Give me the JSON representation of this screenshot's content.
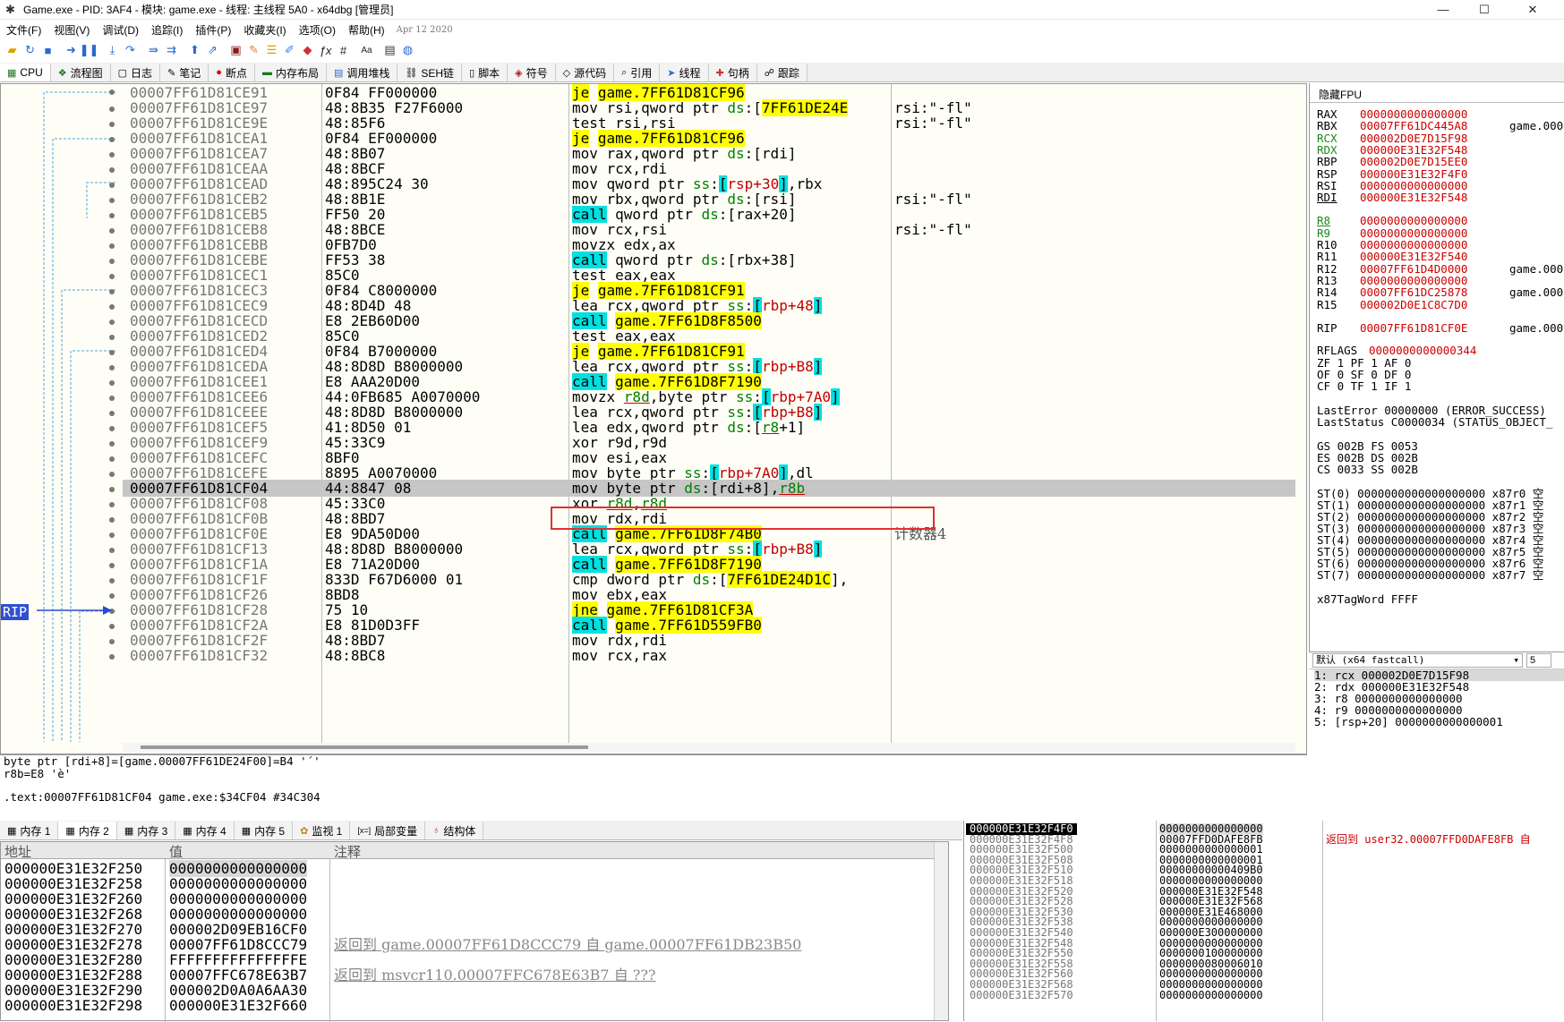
{
  "window": {
    "title": "Game.exe - PID: 3AF4 - 模块: game.exe - 线程: 主线程 5A0 - x64dbg [管理员]"
  },
  "menu": {
    "items": [
      "文件(F)",
      "视图(V)",
      "调试(D)",
      "追踪(I)",
      "插件(P)",
      "收藏夹(I)",
      "选项(O)",
      "帮助(H)"
    ],
    "date": "Apr 12 2020"
  },
  "tabs": [
    {
      "icon": "cpu-icon",
      "label": "CPU"
    },
    {
      "icon": "flowchart-icon",
      "label": "流程图"
    },
    {
      "icon": "log-icon",
      "label": "日志"
    },
    {
      "icon": "notes-icon",
      "label": "笔记"
    },
    {
      "icon": "breakpoint-icon",
      "label": "断点"
    },
    {
      "icon": "memory-map-icon",
      "label": "内存布局"
    },
    {
      "icon": "callstack-icon",
      "label": "调用堆栈"
    },
    {
      "icon": "seh-icon",
      "label": "SEH链"
    },
    {
      "icon": "script-icon",
      "label": "脚本"
    },
    {
      "icon": "symbols-icon",
      "label": "符号"
    },
    {
      "icon": "source-icon",
      "label": "源代码"
    },
    {
      "icon": "references-icon",
      "label": "引用"
    },
    {
      "icon": "threads-icon",
      "label": "线程"
    },
    {
      "icon": "handles-icon",
      "label": "句柄"
    },
    {
      "icon": "trace-icon",
      "label": "跟踪"
    }
  ],
  "disasm": {
    "rows": [
      {
        "addr": "00007FF61D81CE91",
        "bytes": "0F84 FF000000",
        "d": [
          [
            "je",
            "y"
          ],
          [
            " "
          ],
          [
            "game.7FF61D81CF96",
            "y"
          ]
        ],
        "c": ""
      },
      {
        "addr": "00007FF61D81CE97",
        "bytes": "48:8B35 F27F6000",
        "d": [
          [
            "mov rsi,qword ptr "
          ],
          [
            "ds",
            "g"
          ],
          [
            ":["
          ],
          [
            "7FF61DE24E",
            "y"
          ]
        ],
        "c": "rsi:\"-fl\""
      },
      {
        "addr": "00007FF61D81CE9E",
        "bytes": "48:85F6",
        "d": [
          [
            "test rsi,rsi"
          ]
        ],
        "c": "rsi:\"-fl\""
      },
      {
        "addr": "00007FF61D81CEA1",
        "bytes": "0F84 EF000000",
        "d": [
          [
            "je",
            "y"
          ],
          [
            " "
          ],
          [
            "game.7FF61D81CF96",
            "y"
          ]
        ],
        "c": ""
      },
      {
        "addr": "00007FF61D81CEA7",
        "bytes": "48:8B07",
        "d": [
          [
            "mov rax,qword ptr "
          ],
          [
            "ds",
            "g"
          ],
          [
            ":[rdi]"
          ]
        ],
        "c": ""
      },
      {
        "addr": "00007FF61D81CEAA",
        "bytes": "48:8BCF",
        "d": [
          [
            "mov rcx,rdi"
          ]
        ],
        "c": ""
      },
      {
        "addr": "00007FF61D81CEAD",
        "bytes": "48:895C24 30",
        "d": [
          [
            "mov qword ptr "
          ],
          [
            "ss",
            "g"
          ],
          [
            ":"
          ],
          [
            "[",
            "c"
          ],
          [
            "rsp+30",
            "r"
          ],
          [
            "]",
            "c"
          ],
          [
            ",rbx"
          ]
        ],
        "c": ""
      },
      {
        "addr": "00007FF61D81CEB2",
        "bytes": "48:8B1E",
        "d": [
          [
            "mov rbx,qword ptr "
          ],
          [
            "ds",
            "g"
          ],
          [
            ":[rsi]"
          ]
        ],
        "c": "rsi:\"-fl\""
      },
      {
        "addr": "00007FF61D81CEB5",
        "bytes": "FF50 20",
        "d": [
          [
            "call",
            "c"
          ],
          [
            " qword ptr "
          ],
          [
            "ds",
            "g"
          ],
          [
            ":[rax+20]"
          ]
        ],
        "c": ""
      },
      {
        "addr": "00007FF61D81CEB8",
        "bytes": "48:8BCE",
        "d": [
          [
            "mov rcx,rsi"
          ]
        ],
        "c": "rsi:\"-fl\""
      },
      {
        "addr": "00007FF61D81CEBB",
        "bytes": "0FB7D0",
        "d": [
          [
            "movzx edx,ax"
          ]
        ],
        "c": ""
      },
      {
        "addr": "00007FF61D81CEBE",
        "bytes": "FF53 38",
        "d": [
          [
            "call",
            "c"
          ],
          [
            " qword ptr "
          ],
          [
            "ds",
            "g"
          ],
          [
            ":[rbx+38]"
          ]
        ],
        "c": ""
      },
      {
        "addr": "00007FF61D81CEC1",
        "bytes": "85C0",
        "d": [
          [
            "test eax,eax"
          ]
        ],
        "c": ""
      },
      {
        "addr": "00007FF61D81CEC3",
        "bytes": "0F84 C8000000",
        "d": [
          [
            "je",
            "y"
          ],
          [
            " "
          ],
          [
            "game.7FF61D81CF91",
            "y"
          ]
        ],
        "c": ""
      },
      {
        "addr": "00007FF61D81CEC9",
        "bytes": "48:8D4D 48",
        "d": [
          [
            "lea rcx,qword ptr "
          ],
          [
            "ss",
            "g"
          ],
          [
            ":"
          ],
          [
            "[",
            "c"
          ],
          [
            "rbp+48",
            "r"
          ],
          [
            "]",
            "c"
          ]
        ],
        "c": ""
      },
      {
        "addr": "00007FF61D81CECD",
        "bytes": "E8 2EB60D00",
        "d": [
          [
            "call",
            "c"
          ],
          [
            " "
          ],
          [
            "game.7FF61D8F8500",
            "y"
          ]
        ],
        "c": ""
      },
      {
        "addr": "00007FF61D81CED2",
        "bytes": "85C0",
        "d": [
          [
            "test eax,eax"
          ]
        ],
        "c": ""
      },
      {
        "addr": "00007FF61D81CED4",
        "bytes": "0F84 B7000000",
        "d": [
          [
            "je",
            "y"
          ],
          [
            " "
          ],
          [
            "game.7FF61D81CF91",
            "y"
          ]
        ],
        "c": ""
      },
      {
        "addr": "00007FF61D81CEDA",
        "bytes": "48:8D8D B8000000",
        "d": [
          [
            "lea rcx,qword ptr "
          ],
          [
            "ss",
            "g"
          ],
          [
            ":"
          ],
          [
            "[",
            "c"
          ],
          [
            "rbp+B8",
            "r"
          ],
          [
            "]",
            "c"
          ]
        ],
        "c": ""
      },
      {
        "addr": "00007FF61D81CEE1",
        "bytes": "E8 AAA20D00",
        "d": [
          [
            "call",
            "c"
          ],
          [
            " "
          ],
          [
            "game.7FF61D8F7190",
            "y"
          ]
        ],
        "c": ""
      },
      {
        "addr": "00007FF61D81CEE6",
        "bytes": "44:0FB685 A0070000",
        "d": [
          [
            "movzx "
          ],
          [
            "r8d",
            "u"
          ],
          [
            ",byte ptr "
          ],
          [
            "ss",
            "g"
          ],
          [
            ":"
          ],
          [
            "[",
            "c"
          ],
          [
            "rbp+7A0",
            "r"
          ],
          [
            "]",
            "c"
          ]
        ],
        "c": ""
      },
      {
        "addr": "00007FF61D81CEEE",
        "bytes": "48:8D8D B8000000",
        "d": [
          [
            "lea rcx,qword ptr "
          ],
          [
            "ss",
            "g"
          ],
          [
            ":"
          ],
          [
            "[",
            "c"
          ],
          [
            "rbp+B8",
            "r"
          ],
          [
            "]",
            "c"
          ]
        ],
        "c": ""
      },
      {
        "addr": "00007FF61D81CEF5",
        "bytes": "41:8D50 01",
        "d": [
          [
            "lea edx,qword ptr "
          ],
          [
            "ds",
            "g"
          ],
          [
            ":["
          ],
          [
            "r8",
            "u"
          ],
          [
            "+1]"
          ]
        ],
        "c": ""
      },
      {
        "addr": "00007FF61D81CEF9",
        "bytes": "45:33C9",
        "d": [
          [
            "xor r9d,r9d"
          ]
        ],
        "c": ""
      },
      {
        "addr": "00007FF61D81CEFC",
        "bytes": "8BF0",
        "d": [
          [
            "mov esi,eax"
          ]
        ],
        "c": ""
      },
      {
        "addr": "00007FF61D81CEFE",
        "bytes": "8895 A0070000",
        "d": [
          [
            "mov byte ptr "
          ],
          [
            "ss",
            "g"
          ],
          [
            ":"
          ],
          [
            "[",
            "c"
          ],
          [
            "rbp+7A0",
            "r"
          ],
          [
            "]",
            "c"
          ],
          [
            ",dl"
          ]
        ],
        "c": ""
      },
      {
        "addr": "00007FF61D81CF04",
        "bytes": "44:8847 08",
        "d": [
          [
            "mov byte ptr "
          ],
          [
            "ds",
            "g"
          ],
          [
            ":[rdi+8],"
          ],
          [
            "r8b",
            "u"
          ]
        ],
        "c": "",
        "sel": true
      },
      {
        "addr": "00007FF61D81CF08",
        "bytes": "45:33C0",
        "d": [
          [
            "xor "
          ],
          [
            "r8d",
            "u"
          ],
          [
            ","
          ],
          [
            "r8d",
            "u"
          ]
        ],
        "c": ""
      },
      {
        "addr": "00007FF61D81CF0B",
        "bytes": "48:8BD7",
        "d": [
          [
            "mov rdx,rdi"
          ]
        ],
        "c": ""
      },
      {
        "addr": "00007FF61D81CF0E",
        "bytes": "E8 9DA50D00",
        "d": [
          [
            "call",
            "c"
          ],
          [
            " "
          ],
          [
            "game.7FF61D8F74B0",
            "y"
          ]
        ],
        "c": "计数器4",
        "rip": true
      },
      {
        "addr": "00007FF61D81CF13",
        "bytes": "48:8D8D B8000000",
        "d": [
          [
            "lea rcx,qword ptr "
          ],
          [
            "ss",
            "g"
          ],
          [
            ":"
          ],
          [
            "[",
            "c"
          ],
          [
            "rbp+B8",
            "r"
          ],
          [
            "]",
            "c"
          ]
        ],
        "c": ""
      },
      {
        "addr": "00007FF61D81CF1A",
        "bytes": "E8 71A20D00",
        "d": [
          [
            "call",
            "c"
          ],
          [
            " "
          ],
          [
            "game.7FF61D8F7190",
            "y"
          ]
        ],
        "c": ""
      },
      {
        "addr": "00007FF61D81CF1F",
        "bytes": "833D F67D6000 01",
        "d": [
          [
            "cmp dword ptr "
          ],
          [
            "ds",
            "g"
          ],
          [
            ":["
          ],
          [
            "7FF61DE24D1C",
            "y"
          ],
          [
            "],"
          ]
        ],
        "c": ""
      },
      {
        "addr": "00007FF61D81CF26",
        "bytes": "8BD8",
        "d": [
          [
            "mov ebx,eax"
          ]
        ],
        "c": ""
      },
      {
        "addr": "00007FF61D81CF28",
        "bytes": "75 10",
        "d": [
          [
            "jne",
            "y"
          ],
          [
            " "
          ],
          [
            "game.7FF61D81CF3A",
            "y"
          ]
        ],
        "c": ""
      },
      {
        "addr": "00007FF61D81CF2A",
        "bytes": "E8 81D0D3FF",
        "d": [
          [
            "call",
            "c"
          ],
          [
            " "
          ],
          [
            "game.7FF61D559FB0",
            "y"
          ]
        ],
        "c": ""
      },
      {
        "addr": "00007FF61D81CF2F",
        "bytes": "48:8BD7",
        "d": [
          [
            "mov rdx,rdi"
          ]
        ],
        "c": ""
      },
      {
        "addr": "00007FF61D81CF32",
        "bytes": "48:8BC8",
        "d": [
          [
            "mov rcx,rax"
          ]
        ],
        "c": ""
      }
    ],
    "rip_label": "RIP"
  },
  "info": {
    "line1": "byte ptr [rdi+8]=[game.00007FF61DE24F00]=B4 '´'",
    "line2": "r8b=E8 'è'",
    "line3": ".text:00007FF61D81CF04 game.exe:$34CF04 #34C304"
  },
  "registers": {
    "header": "隐藏FPU",
    "gp": [
      {
        "n": "RAX",
        "v": "0000000000000000",
        "a": ""
      },
      {
        "n": "RBX",
        "v": "00007FF61DC445A8",
        "a": "game.000"
      },
      {
        "n": "RCX",
        "v": "000002D0E7D15F98",
        "a": "",
        "nc": "green"
      },
      {
        "n": "RDX",
        "v": "000000E31E32F548",
        "a": "",
        "nc": "green"
      },
      {
        "n": "RBP",
        "v": "000002D0E7D15EE0",
        "a": ""
      },
      {
        "n": "RSP",
        "v": "000000E31E32F4F0",
        "a": ""
      },
      {
        "n": "RSI",
        "v": "0000000000000000",
        "a": ""
      },
      {
        "n": "RDI",
        "v": "000000E31E32F548",
        "a": "",
        "nu": true
      },
      {
        "n": "R8",
        "v": "0000000000000000",
        "a": "",
        "nc": "green",
        "nu": true,
        "gap": true
      },
      {
        "n": "R9",
        "v": "0000000000000000",
        "a": "",
        "nc": "green"
      },
      {
        "n": "R10",
        "v": "0000000000000000",
        "a": ""
      },
      {
        "n": "R11",
        "v": "000000E31E32F540",
        "a": ""
      },
      {
        "n": "R12",
        "v": "00007FF61D4D0000",
        "a": "game.000"
      },
      {
        "n": "R13",
        "v": "0000000000000000",
        "a": ""
      },
      {
        "n": "R14",
        "v": "00007FF61DC25878",
        "a": "game.000"
      },
      {
        "n": "R15",
        "v": "000002D0E1C8C7D0",
        "a": ""
      },
      {
        "n": "RIP",
        "v": "00007FF61D81CF0E",
        "a": "game.000",
        "gap": true
      }
    ],
    "rflags_label": "RFLAGS",
    "rflags": "0000000000000344",
    "flags": [
      "ZF 1  PF 1  AF 0",
      "OF 0  SF 0  DF 0",
      "CF 0  TF 1  IF 1"
    ],
    "lasterror": "LastError  00000000 (ERROR_SUCCESS)",
    "laststatus": "LastStatus C0000034 (STATUS_OBJECT_",
    "seg": [
      "GS 002B  FS 0053",
      "ES 002B  DS 002B",
      "CS 0033  SS 002B"
    ],
    "st": [
      "ST(0) 0000000000000000000 x87r0 空",
      "ST(1) 0000000000000000000 x87r1 空",
      "ST(2) 0000000000000000000 x87r2 空",
      "ST(3) 0000000000000000000 x87r3 空",
      "ST(4) 0000000000000000000 x87r4 空",
      "ST(5) 0000000000000000000 x87r5 空",
      "ST(6) 0000000000000000000 x87r6 空",
      "ST(7) 0000000000000000000 x87r7 空"
    ],
    "tagword": "x87TagWord FFFF"
  },
  "callconv": {
    "label": "默认 (x64 fastcall)",
    "count": "5"
  },
  "args": [
    "1: rcx 000002D0E7D15F98",
    "2: rdx 000000E31E32F548",
    "3: r8 0000000000000000",
    "4: r9 0000000000000000",
    "5: [rsp+20] 0000000000000001"
  ],
  "bottom_tabs": [
    {
      "icon": "memory-icon",
      "label": "内存 1"
    },
    {
      "icon": "memory-icon",
      "label": "内存 2"
    },
    {
      "icon": "memory-icon",
      "label": "内存 3"
    },
    {
      "icon": "memory-icon",
      "label": "内存 4"
    },
    {
      "icon": "memory-icon",
      "label": "内存 5"
    },
    {
      "icon": "watch-icon",
      "label": "监视 1"
    },
    {
      "icon": "locals-icon",
      "label": "局部变量"
    },
    {
      "icon": "struct-icon",
      "label": "结构体"
    }
  ],
  "dump": {
    "headers": {
      "addr": "地址",
      "value": "值",
      "comment": "注释"
    },
    "rows": [
      {
        "a": "000000E31E32F250",
        "v": "0000000000000000",
        "c": ""
      },
      {
        "a": "000000E31E32F258",
        "v": "0000000000000000",
        "c": ""
      },
      {
        "a": "000000E31E32F260",
        "v": "0000000000000000",
        "c": ""
      },
      {
        "a": "000000E31E32F268",
        "v": "0000000000000000",
        "c": ""
      },
      {
        "a": "000000E31E32F270",
        "v": "000002D09EB16CF0",
        "c": ""
      },
      {
        "a": "000000E31E32F278",
        "v": "00007FF61D8CCC79",
        "c": "返回到 game.00007FF61D8CCC79 自 game.00007FF61DB23B50"
      },
      {
        "a": "000000E31E32F280",
        "v": "FFFFFFFFFFFFFFFE",
        "c": ""
      },
      {
        "a": "000000E31E32F288",
        "v": "00007FFC678E63B7",
        "c": "返回到 msvcr110.00007FFC678E63B7 自 ???"
      },
      {
        "a": "000000E31E32F290",
        "v": "000002D0A0A6AA30",
        "c": ""
      },
      {
        "a": "000000E31E32F298",
        "v": "000000E31E32F660",
        "c": ""
      }
    ]
  },
  "stack": {
    "rows": [
      {
        "a": "000000E31E32F4F0",
        "v": "0000000000000000",
        "c": ""
      },
      {
        "a": "000000E31E32F4F8",
        "v": "00007FFD0DAFE8FB",
        "c": "返回到 user32.00007FFD0DAFE8FB 自"
      },
      {
        "a": "000000E31E32F500",
        "v": "0000000000000001",
        "c": ""
      },
      {
        "a": "000000E31E32F508",
        "v": "0000000000000001",
        "c": ""
      },
      {
        "a": "000000E31E32F510",
        "v": "00000000000409B0",
        "c": ""
      },
      {
        "a": "000000E31E32F518",
        "v": "0000000000000000",
        "c": ""
      },
      {
        "a": "000000E31E32F520",
        "v": "000000E31E32F548",
        "c": ""
      },
      {
        "a": "000000E31E32F528",
        "v": "000000E31E32F568",
        "c": ""
      },
      {
        "a": "000000E31E32F530",
        "v": "000000E31E468000",
        "c": ""
      },
      {
        "a": "000000E31E32F538",
        "v": "0000000000000000",
        "c": ""
      },
      {
        "a": "000000E31E32F540",
        "v": "000000E300000000",
        "c": ""
      },
      {
        "a": "000000E31E32F548",
        "v": "0000000000000000",
        "c": ""
      },
      {
        "a": "000000E31E32F550",
        "v": "0000000100000000",
        "c": ""
      },
      {
        "a": "000000E31E32F558",
        "v": "0000000080006010",
        "c": ""
      },
      {
        "a": "000000E31E32F560",
        "v": "0000000000000000",
        "c": ""
      },
      {
        "a": "000000E31E32F568",
        "v": "0000000000000000",
        "c": ""
      },
      {
        "a": "000000E31E32F570",
        "v": "0000000000000000",
        "c": ""
      }
    ]
  }
}
